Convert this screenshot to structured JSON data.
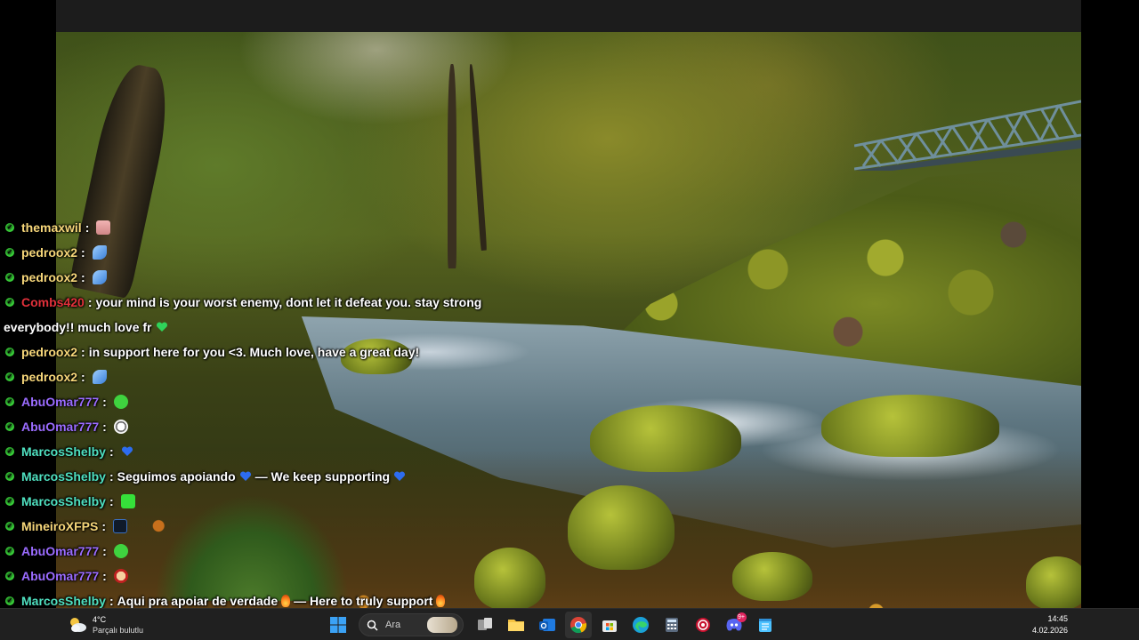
{
  "colors": {
    "badge_green": "#3ad23a",
    "user_yellow": "#f7d77a",
    "user_red": "#e0303a",
    "user_purple": "#9b6cff",
    "user_teal": "#4fe0c0",
    "taskbar_bg": "#202020"
  },
  "chat": {
    "messages": [
      {
        "user": "themaxwil",
        "sep": ":",
        "text": "",
        "suffix": "",
        "user_color": "#f7d77a",
        "emote": "pink-face-emote"
      },
      {
        "user": "pedroox2",
        "sep": ":",
        "text": "",
        "suffix": "",
        "user_color": "#f7d77a",
        "emote": "blue-wing-emote"
      },
      {
        "user": "pedroox2",
        "sep": ":",
        "text": "",
        "suffix": "",
        "user_color": "#f7d77a",
        "emote": "blue-wing-emote"
      },
      {
        "user": "Combs420",
        "sep": ":",
        "text": "your mind is your worst enemy, dont let it defeat you. stay strong",
        "suffix": "",
        "user_color": "#e0303a",
        "emote": ""
      },
      {
        "user": "",
        "sep": "",
        "text": "everybody!! much love fr",
        "suffix": "",
        "user_color": "",
        "emote": "green-heart"
      },
      {
        "user": "pedroox2",
        "sep": ":",
        "text": "in support here for you <3. Much love, have a great day!",
        "suffix": "",
        "user_color": "#f7d77a",
        "emote": ""
      },
      {
        "user": "pedroox2",
        "sep": ":",
        "text": "",
        "suffix": "",
        "user_color": "#f7d77a",
        "emote": "blue-wing-emote"
      },
      {
        "user": "AbuOmar777",
        "sep": ":",
        "text": "",
        "suffix": "",
        "user_color": "#9b6cff",
        "emote": "green-blob-emote"
      },
      {
        "user": "AbuOmar777",
        "sep": ":",
        "text": "",
        "suffix": "",
        "user_color": "#9b6cff",
        "emote": "soccer-ball-emote"
      },
      {
        "user": "MarcosShelby",
        "sep": ":",
        "text": "",
        "suffix": "",
        "user_color": "#4fe0c0",
        "emote": "blue-heart"
      },
      {
        "user": "MarcosShelby",
        "sep": ":",
        "text": "Seguimos apoiando",
        "suffix": "— We keep supporting",
        "user_color": "#4fe0c0",
        "emote": "blue-heart"
      },
      {
        "user": "MarcosShelby",
        "sep": ":",
        "text": "",
        "suffix": "",
        "user_color": "#4fe0c0",
        "emote": "green-k-emote"
      },
      {
        "user": "MineiroXFPS",
        "sep": ":",
        "text": "",
        "suffix": "",
        "user_color": "#f7d77a",
        "emote": "dark-badge-emote"
      },
      {
        "user": "AbuOmar777",
        "sep": ":",
        "text": "",
        "suffix": "",
        "user_color": "#9b6cff",
        "emote": "green-blob-emote"
      },
      {
        "user": "AbuOmar777",
        "sep": ":",
        "text": "",
        "suffix": "",
        "user_color": "#9b6cff",
        "emote": "red-face-emote"
      },
      {
        "user": "MarcosShelby",
        "sep": ":",
        "text": "Aqui pra apoiar de verdade",
        "suffix": "— Here to truly support",
        "user_color": "#4fe0c0",
        "emote": "fire"
      }
    ]
  },
  "taskbar": {
    "weather": {
      "temp": "4°C",
      "desc": "Parçalı bulutlu",
      "icon": "partly-cloudy-icon"
    },
    "search_placeholder": "Ara",
    "apps": [
      {
        "name": "start-button",
        "icon": "windows-logo-icon"
      },
      {
        "name": "search-box",
        "icon": "search-icon"
      },
      {
        "name": "task-view-button",
        "icon": "task-view-icon"
      },
      {
        "name": "file-explorer-button",
        "icon": "folder-icon"
      },
      {
        "name": "outlook-button",
        "icon": "mail-icon"
      },
      {
        "name": "chrome-button",
        "icon": "chrome-icon"
      },
      {
        "name": "store-button",
        "icon": "store-icon"
      },
      {
        "name": "edge-button",
        "icon": "edge-icon"
      },
      {
        "name": "calculator-button",
        "icon": "calculator-icon"
      },
      {
        "name": "red-app-button",
        "icon": "red-circle-icon"
      },
      {
        "name": "discord-button",
        "icon": "discord-icon",
        "badge": "9+"
      },
      {
        "name": "notepad-button",
        "icon": "notepad-icon"
      }
    ],
    "clock": {
      "time": "14:45",
      "date": "4.02.2026"
    }
  }
}
